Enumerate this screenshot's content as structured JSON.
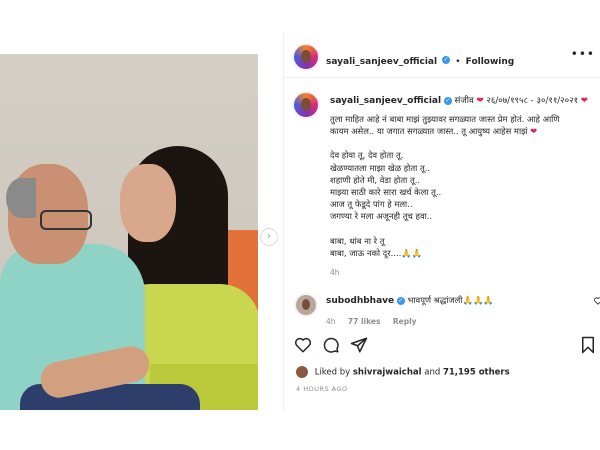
{
  "post": {
    "username": "sayali_sanjeev_official",
    "follow_separator": "•",
    "follow_label": "Following",
    "more_label": "•••",
    "caption_prefix": "संजीव",
    "caption_dates": "२६/०७/१९५८ - ३०/११/२०२१",
    "caption_lines": [
      "तुला माहित आहे नं बाबा माझं तुझ्यावर सगळ्यात जास्त प्रेम होतं. आहे आणि",
      "कायम असेल.. या जगात सगळ्यात जास्त.. तू आयुष्य आहेस माझं",
      "देव होवा तू, देव होता तू.",
      "खेळण्यातला माझा खेळ होता तू..",
      "शहाणी होते मी, वेडा होता तू..",
      "माझ्या साठी कारे सारा खर्च केला तू..",
      "आज तू फेडूदे पांग हे मला..",
      "जगण्या रे मला अजूनही तूच हवा..",
      "बाबा, थांब ना रे तू",
      "बाबा, जाऊ नको दूर....🙏🙏"
    ],
    "caption_time": "4h",
    "heart": "❤"
  },
  "comment": {
    "username": "subodhbhave",
    "text": "भावपूर्ण श्रद्धांजली🙏🙏🙏",
    "time": "4h",
    "likes": "77 likes",
    "reply": "Reply"
  },
  "actions": {
    "like_icon": "heart-outline-icon",
    "comment_icon": "comment-icon",
    "share_icon": "paper-plane-icon",
    "save_icon": "bookmark-icon"
  },
  "likes_line": {
    "prefix": "Liked by ",
    "user": "shivrajwaichal",
    "middle": " and ",
    "count": "71,195 others"
  },
  "timestamp": "4 HOURS AGO",
  "carousel_arrow": "›",
  "colors": {
    "verified": "#3897f0",
    "heart": "#e0245e",
    "text": "#262626",
    "muted": "#8e8e8e"
  }
}
